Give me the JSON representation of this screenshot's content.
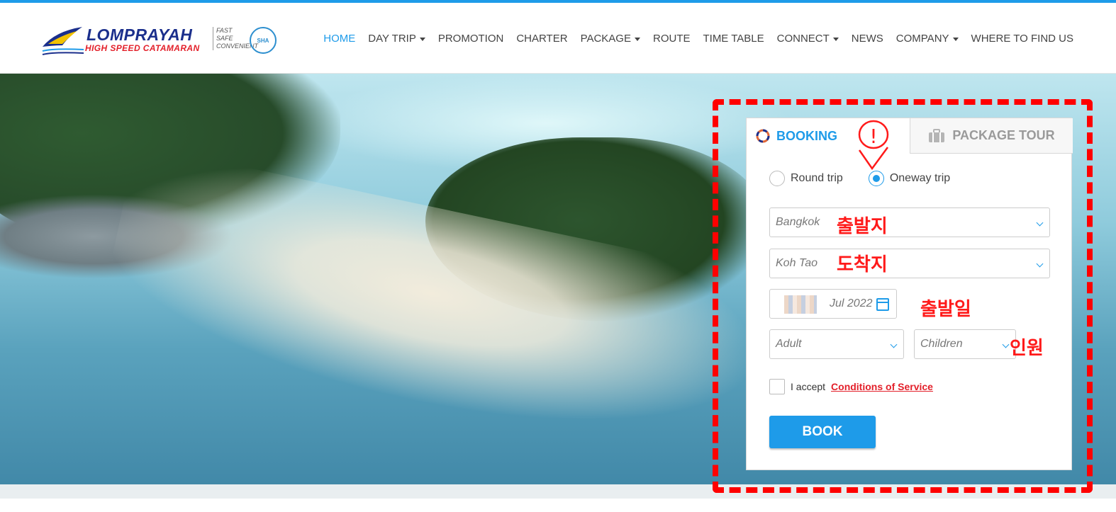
{
  "brand": {
    "name": "LOMPRAYAH",
    "subtitle": "HIGH SPEED CATAMARAN",
    "tagline": "FAST\nSAFE\nCONVENIENT",
    "badge": "SHA"
  },
  "nav": {
    "items": [
      {
        "label": "HOME",
        "active": true,
        "dropdown": false
      },
      {
        "label": "DAY TRIP",
        "active": false,
        "dropdown": true
      },
      {
        "label": "PROMOTION",
        "active": false,
        "dropdown": false
      },
      {
        "label": "CHARTER",
        "active": false,
        "dropdown": false
      },
      {
        "label": "PACKAGE",
        "active": false,
        "dropdown": true
      },
      {
        "label": "ROUTE",
        "active": false,
        "dropdown": false
      },
      {
        "label": "TIME TABLE",
        "active": false,
        "dropdown": false
      },
      {
        "label": "CONNECT",
        "active": false,
        "dropdown": true
      },
      {
        "label": "NEWS",
        "active": false,
        "dropdown": false
      },
      {
        "label": "COMPANY",
        "active": false,
        "dropdown": true
      },
      {
        "label": "WHERE TO FIND US",
        "active": false,
        "dropdown": false
      }
    ]
  },
  "booking": {
    "tab_booking": "BOOKING",
    "tab_package": "PACKAGE TOUR",
    "trip_round": "Round trip",
    "trip_oneway": "Oneway trip",
    "selected_trip": "oneway",
    "from_value": "Bangkok",
    "to_value": "Koh Tao",
    "date_value": "Jul 2022",
    "adult_placeholder": "Adult",
    "children_placeholder": "Children",
    "accept_text": "I accept",
    "conditions_link": "Conditions of Service",
    "book_label": "BOOK"
  },
  "annotations": {
    "from_label": "출발지",
    "to_label": "도착지",
    "date_label": "출발일",
    "people_label": "인원",
    "scribble_text": "!"
  },
  "colors": {
    "accent": "#1e9be9",
    "annotation": "#ff0000",
    "link": "#e3202a"
  }
}
